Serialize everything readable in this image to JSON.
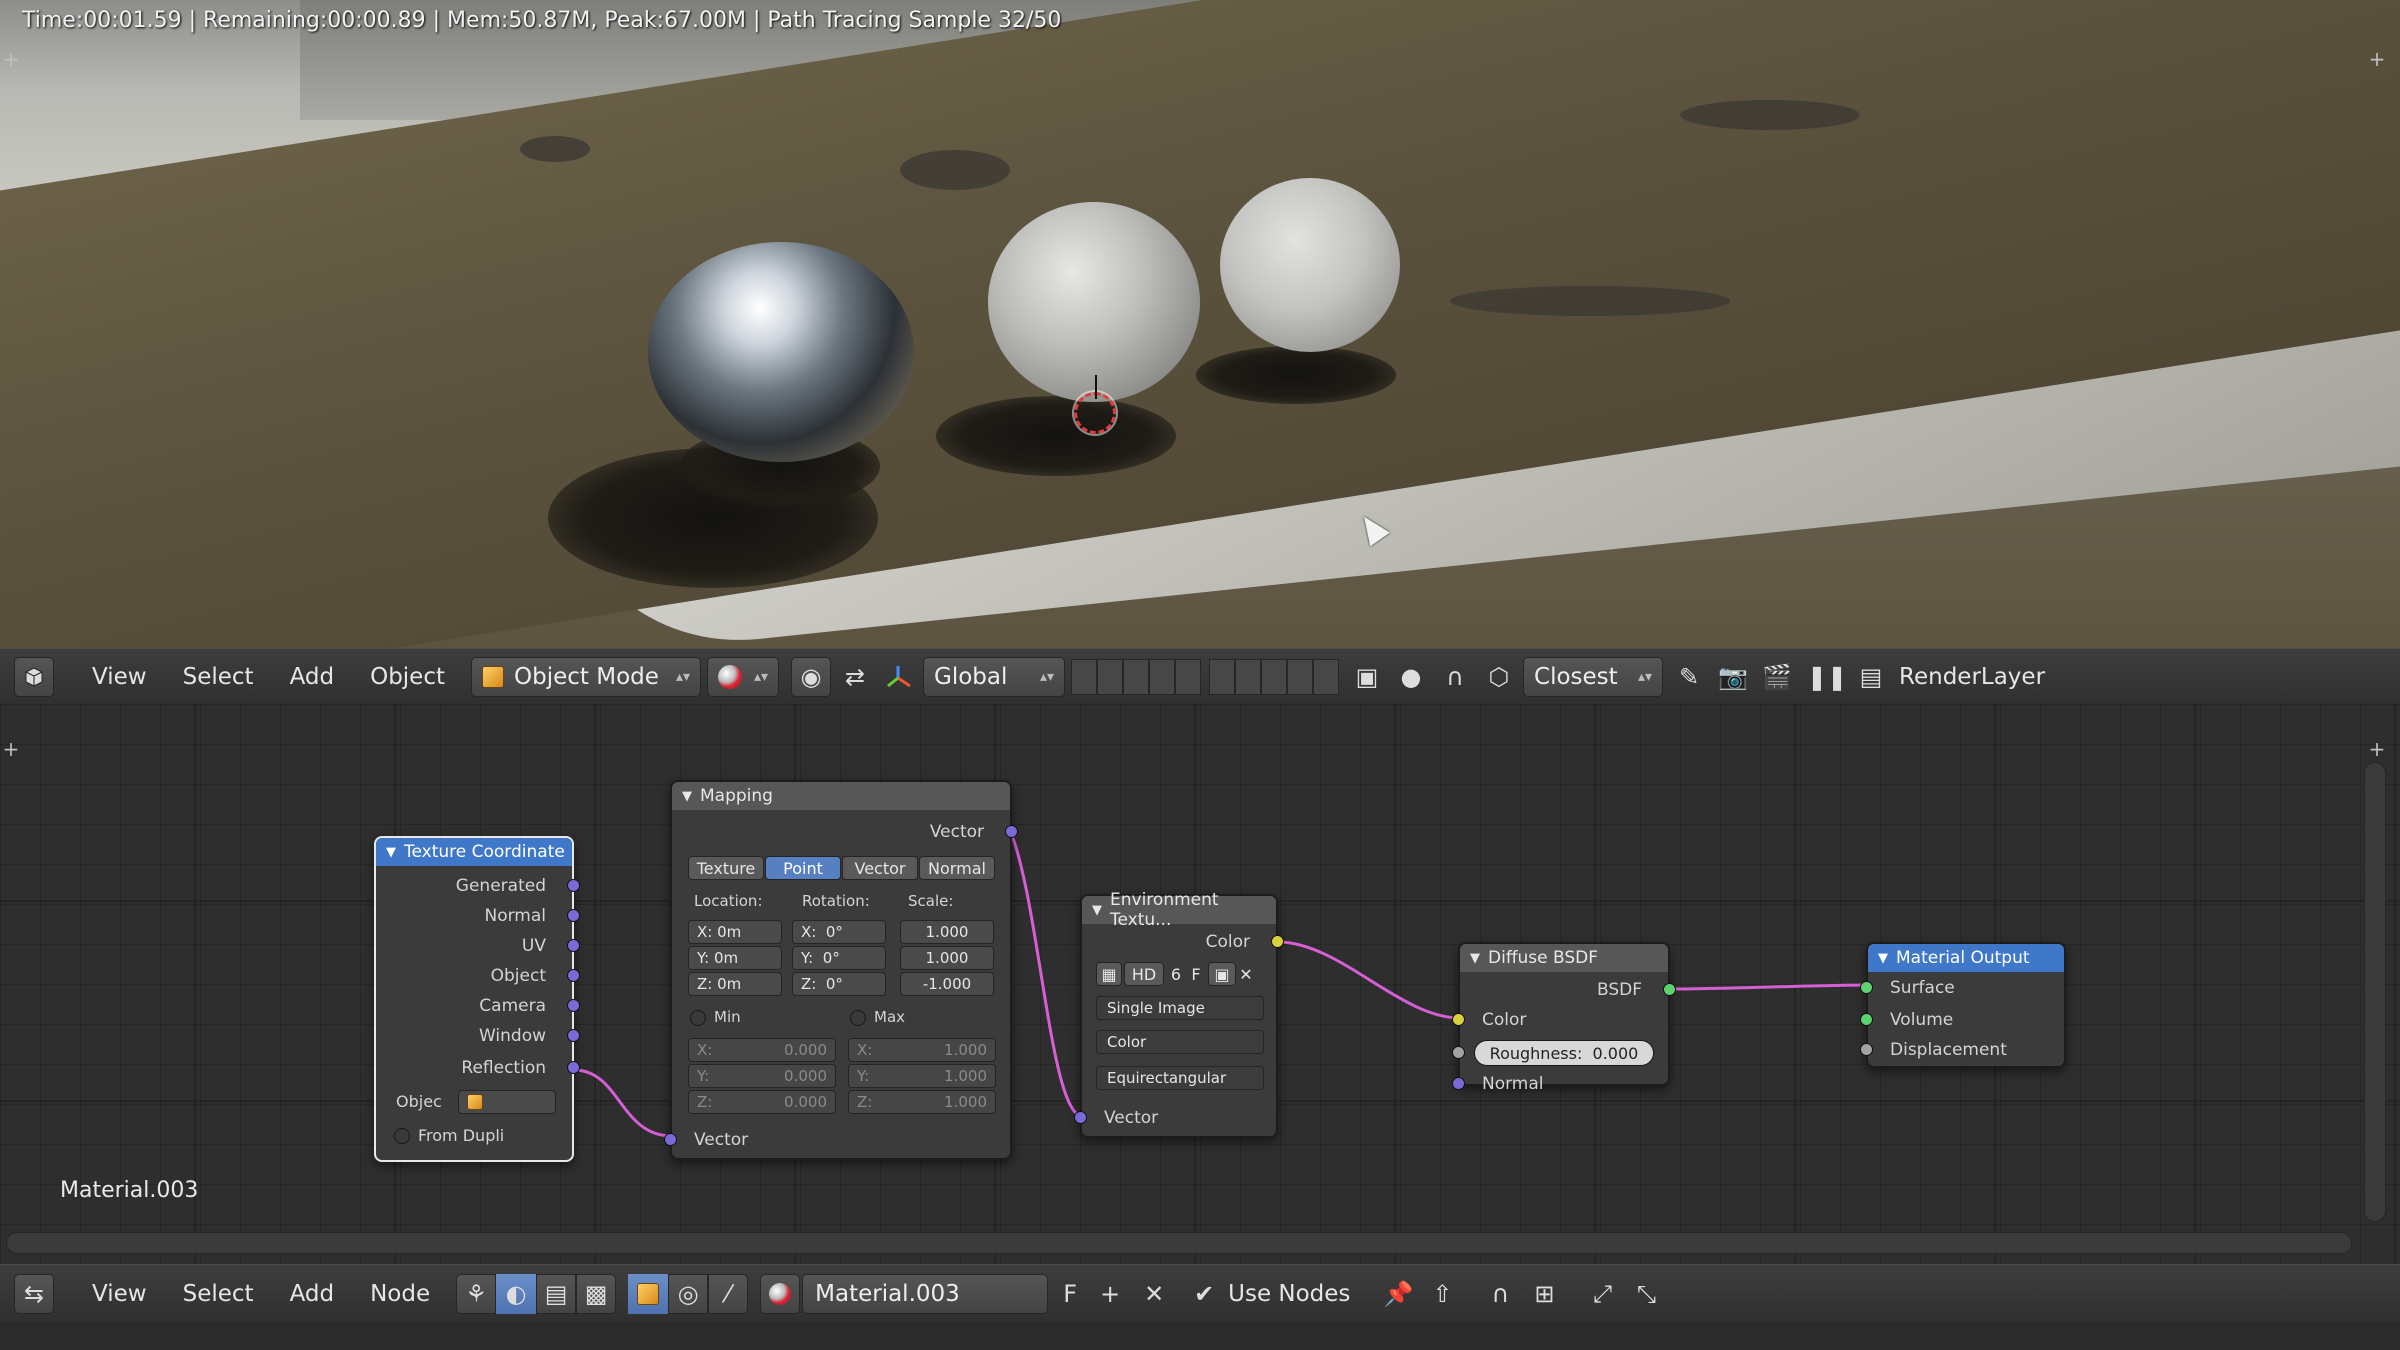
{
  "viewport": {
    "status_text": "Time:00:01.59 | Remaining:00:00.89 | Mem:50.87M, Peak:67.00M | Path Tracing Sample 32/50"
  },
  "header_3d": {
    "menu": [
      "View",
      "Select",
      "Add",
      "Object"
    ],
    "mode": "Object Mode",
    "orientation": "Global",
    "snap": "Closest",
    "render_layer": "RenderLayer"
  },
  "node_editor": {
    "material_label": "Material.003",
    "nodes": {
      "texture_coordinate": {
        "title": "Texture Coordinate",
        "outputs": [
          "Generated",
          "Normal",
          "UV",
          "Object",
          "Camera",
          "Window",
          "Reflection"
        ],
        "object_label": "Objec",
        "from_dupli": "From Dupli"
      },
      "mapping": {
        "title": "Mapping",
        "output": "Vector",
        "tabs": [
          "Texture",
          "Point",
          "Vector",
          "Normal"
        ],
        "active_tab": "Point",
        "location_label": "Location:",
        "rotation_label": "Rotation:",
        "scale_label": "Scale:",
        "location": [
          {
            "k": "X:",
            "v": "0m"
          },
          {
            "k": "Y:",
            "v": "0m"
          },
          {
            "k": "Z:",
            "v": "0m"
          }
        ],
        "rotation": [
          {
            "k": "X:",
            "v": "0°"
          },
          {
            "k": "Y:",
            "v": "0°"
          },
          {
            "k": "Z:",
            "v": "0°"
          }
        ],
        "scale": [
          {
            "k": "",
            "v": "1.000"
          },
          {
            "k": "",
            "v": "1.000"
          },
          {
            "k": "",
            "v": "-1.000"
          }
        ],
        "min_label": "Min",
        "max_label": "Max",
        "min": [
          {
            "k": "X:",
            "v": "0.000"
          },
          {
            "k": "Y:",
            "v": "0.000"
          },
          {
            "k": "Z:",
            "v": "0.000"
          }
        ],
        "max": [
          {
            "k": "X:",
            "v": "1.000"
          },
          {
            "k": "Y:",
            "v": "1.000"
          },
          {
            "k": "Z:",
            "v": "1.000"
          }
        ],
        "input": "Vector"
      },
      "environment_texture": {
        "title": "Environment Textu...",
        "output": "Color",
        "image_name": "HD",
        "users": "6",
        "fake_user": "F",
        "source": "Single Image",
        "color_space": "Color",
        "projection": "Equirectangular",
        "input": "Vector"
      },
      "diffuse_bsdf": {
        "title": "Diffuse BSDF",
        "output": "BSDF",
        "color_input": "Color",
        "roughness_label": "Roughness:",
        "roughness_value": "0.000",
        "normal_input": "Normal"
      },
      "material_output": {
        "title": "Material Output",
        "inputs": [
          "Surface",
          "Volume",
          "Displacement"
        ]
      }
    }
  },
  "header_node": {
    "menu": [
      "View",
      "Select",
      "Add",
      "Node"
    ],
    "material": "Material.003",
    "fake_user": "F",
    "use_nodes_label": "Use Nodes",
    "use_nodes_checked": true
  },
  "colors": {
    "socket_vector": "#7a6ad8",
    "socket_color": "#d8d03c",
    "socket_shader": "#5cd36e",
    "link": "#d65fd6",
    "node_selected_header": "#3f78c8"
  }
}
